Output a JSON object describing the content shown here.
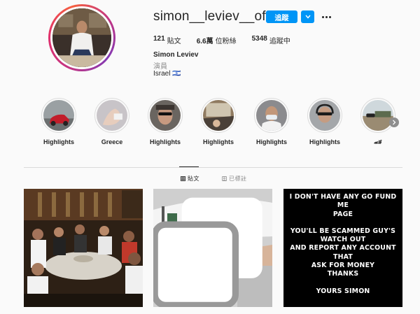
{
  "profile": {
    "username": "simon__leviev__official",
    "follow_label": "追蹤",
    "stats": {
      "posts_count": "121",
      "posts_label": "貼文",
      "followers_count": "6.6萬",
      "followers_label": "位粉絲",
      "following_count": "5348",
      "following_label": "追蹤中"
    },
    "full_name": "Simon Leviev",
    "category": "演員",
    "location": "Israel 🇮🇱"
  },
  "highlights": [
    {
      "label": "Highlights",
      "icon": "red-car-thumbnail"
    },
    {
      "label": "Greece",
      "icon": "hand-thumbnail"
    },
    {
      "label": "Highlights",
      "icon": "sunglasses-portrait-thumbnail"
    },
    {
      "label": "Highlights",
      "icon": "car-window-thumbnail"
    },
    {
      "label": "Highlights",
      "icon": "masked-driver-thumbnail"
    },
    {
      "label": "Highlights",
      "icon": "pilot-headset-thumbnail"
    },
    {
      "label": "🏎",
      "icon": "car-on-road-thumbnail"
    }
  ],
  "tabs": {
    "posts_label": "貼文",
    "tagged_label": "已標註"
  },
  "posts": {
    "post3_text": {
      "line1": "I DON'T HAVE ANY GO FUND ME",
      "line2": "PAGE",
      "line3": "YOU'LL BE SCAMMED GUY'S",
      "line4": "WATCH OUT",
      "line5": "AND REPORT ANY ACCOUNT THAT",
      "line6": "ASK FOR MONEY",
      "line7": "THANKS",
      "line8": "YOURS SIMON"
    }
  },
  "colors": {
    "accent": "#0095f6",
    "text": "#262626",
    "muted": "#8e8e8e",
    "border": "#dbdbdb",
    "background": "#fafafa"
  }
}
